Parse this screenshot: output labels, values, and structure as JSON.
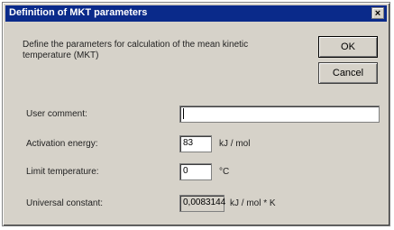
{
  "window": {
    "title": "Definition of MKT parameters",
    "close_glyph": "×"
  },
  "description": "Define the parameters for calculation of the mean kinetic temperature (MKT)",
  "buttons": {
    "ok": "OK",
    "cancel": "Cancel"
  },
  "fields": [
    {
      "label": "User comment:",
      "value": "",
      "unit": ""
    },
    {
      "label": "Activation energy:",
      "value": "83",
      "unit": "kJ / mol"
    },
    {
      "label": "Limit temperature:",
      "value": "0",
      "unit": "°C"
    },
    {
      "label": "Universal constant:",
      "value": "0,0083144",
      "unit": "kJ / mol * K"
    }
  ]
}
